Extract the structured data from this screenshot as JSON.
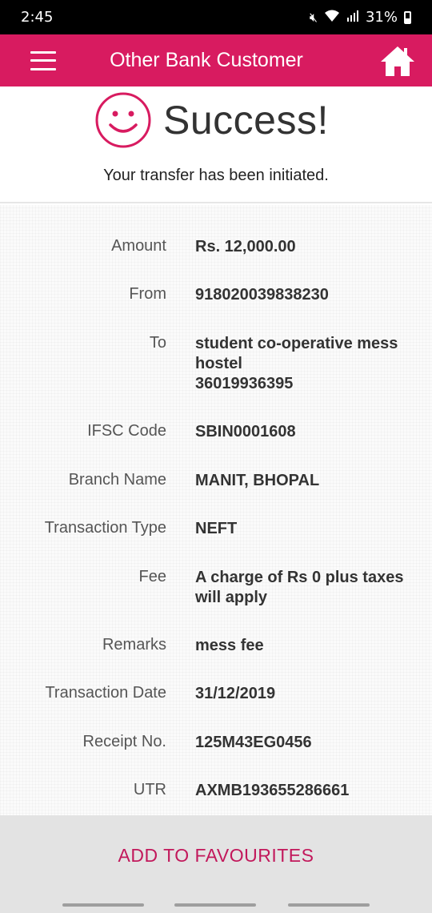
{
  "status_bar": {
    "time": "2:45",
    "battery": "31%"
  },
  "app_bar": {
    "title": "Other Bank Customer"
  },
  "success": {
    "title": "Success!",
    "message": "Your transfer has been initiated."
  },
  "details": {
    "amount_label": "Amount",
    "amount_value": "Rs. 12,000.00",
    "from_label": "From",
    "from_value": "918020039838230",
    "to_label": "To",
    "to_name_line1": "student co-operative mess",
    "to_name_line2": "hostel",
    "to_account": "36019936395",
    "ifsc_label": "IFSC Code",
    "ifsc_value": "SBIN0001608",
    "branch_label": "Branch Name",
    "branch_value": "MANIT, BHOPAL",
    "type_label": "Transaction Type",
    "type_value": "NEFT",
    "fee_label": "Fee",
    "fee_line1": "A charge of Rs 0 plus taxes",
    "fee_line2": "will apply",
    "remarks_label": "Remarks",
    "remarks_value": "mess fee",
    "date_label": "Transaction Date",
    "date_value": "31/12/2019",
    "receipt_label": "Receipt No.",
    "receipt_value": "125M43EG0456",
    "utr_label": "UTR",
    "utr_value": "AXMB193655286661"
  },
  "actions": {
    "add_to_favourites": "ADD TO FAVOURITES"
  },
  "colors": {
    "accent": "#d81b60",
    "button_text": "#c2185b"
  }
}
